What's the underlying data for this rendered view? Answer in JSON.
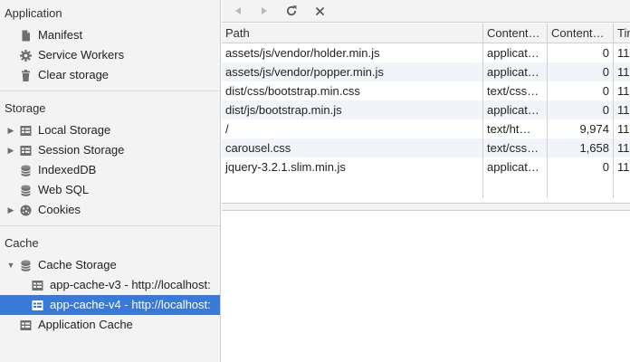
{
  "sidebar": {
    "application": {
      "title": "Application",
      "items": [
        {
          "label": "Manifest",
          "icon": "document-icon"
        },
        {
          "label": "Service Workers",
          "icon": "gear-icon"
        },
        {
          "label": "Clear storage",
          "icon": "trash-icon"
        }
      ]
    },
    "storage": {
      "title": "Storage",
      "items": [
        {
          "label": "Local Storage",
          "icon": "grid-icon",
          "expandable": true
        },
        {
          "label": "Session Storage",
          "icon": "grid-icon",
          "expandable": true
        },
        {
          "label": "IndexedDB",
          "icon": "database-icon"
        },
        {
          "label": "Web SQL",
          "icon": "database-icon"
        },
        {
          "label": "Cookies",
          "icon": "cookie-icon",
          "expandable": true
        }
      ]
    },
    "cache": {
      "title": "Cache",
      "items": [
        {
          "label": "Cache Storage",
          "icon": "database-icon",
          "expanded": true
        },
        {
          "label": "app-cache-v3 - http://localhost:",
          "icon": "grid-icon"
        },
        {
          "label": "app-cache-v4 - http://localhost:",
          "icon": "grid-icon",
          "selected": true
        },
        {
          "label": "Application Cache",
          "icon": "grid-icon"
        }
      ]
    }
  },
  "toolbar": {
    "back_icon": "triangle-left-icon",
    "forward_icon": "triangle-right-icon",
    "refresh_icon": "refresh-icon",
    "delete_icon": "close-icon"
  },
  "table": {
    "columns": [
      "Path",
      "Content…",
      "Content…",
      "Tin"
    ],
    "rows": [
      [
        "assets/js/vendor/holder.min.js",
        "applicat…",
        "0",
        "11"
      ],
      [
        "assets/js/vendor/popper.min.js",
        "applicat…",
        "0",
        "11"
      ],
      [
        "dist/css/bootstrap.min.css",
        "text/css…",
        "0",
        "11"
      ],
      [
        "dist/js/bootstrap.min.js",
        "applicat…",
        "0",
        "11"
      ],
      [
        "/",
        "text/ht…",
        "9,974",
        "11"
      ],
      [
        "carousel.css",
        "text/css…",
        "1,658",
        "11"
      ],
      [
        "jquery-3.2.1.slim.min.js",
        "applicat…",
        "0",
        "11"
      ]
    ]
  },
  "colors": {
    "selected_bg": "#3879d9",
    "sidebar_bg": "#f3f3f3",
    "alt_row_bg": "#f1f5fa"
  }
}
